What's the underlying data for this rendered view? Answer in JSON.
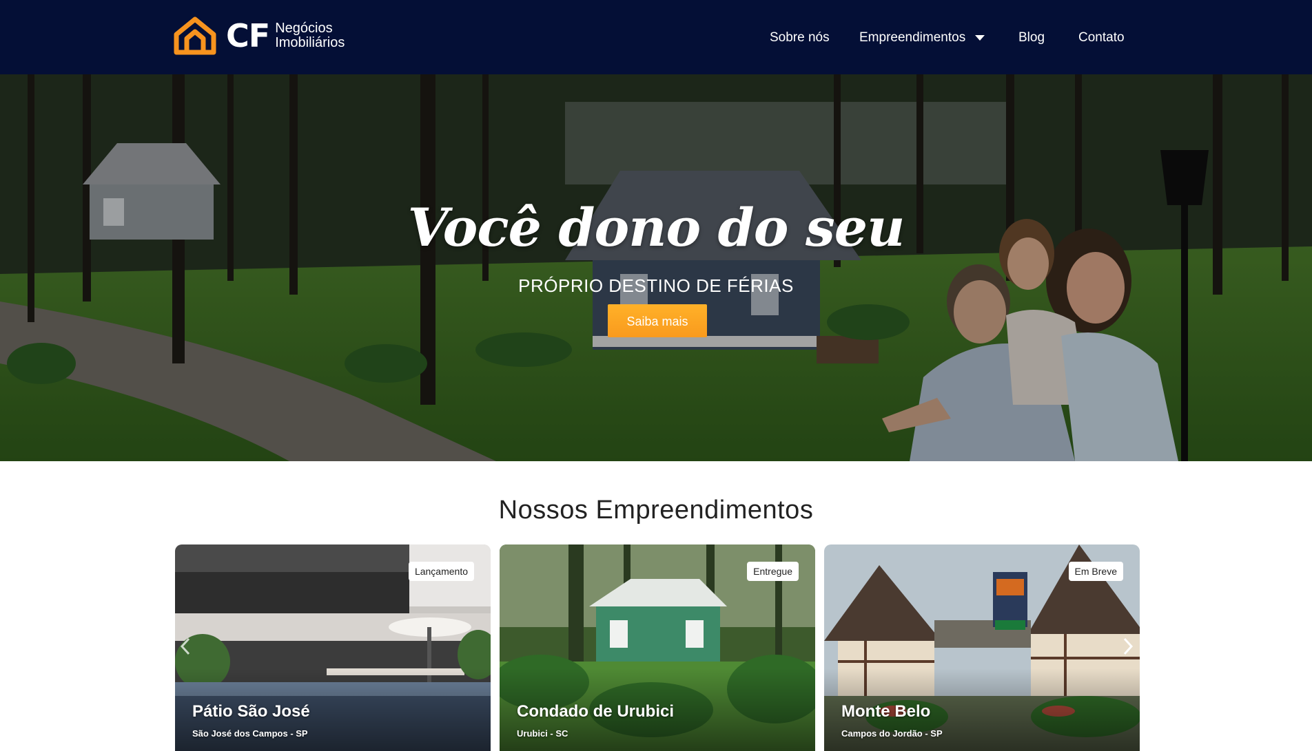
{
  "header": {
    "logo": {
      "mark": "CF",
      "line1": "Negócios",
      "line2": "Imobiliários"
    },
    "nav": [
      {
        "label": "Sobre nós"
      },
      {
        "label": "Empreendimentos",
        "icon": "caret-down-icon"
      },
      {
        "label": "Blog"
      },
      {
        "label": "Contato"
      }
    ]
  },
  "hero": {
    "title": "Você dono do seu",
    "subtitle": "PRÓPRIO DESTINO DE FÉRIAS",
    "button": "Saiba mais"
  },
  "projects": {
    "title": "Nossos Empreendimentos",
    "cards": [
      {
        "badge": "Lançamento",
        "name": "Pátio São José",
        "location": "São José dos Campos - SP"
      },
      {
        "badge": "Entregue",
        "name": "Condado de Urubici",
        "location": "Urubici - SC"
      },
      {
        "badge": "Em Breve",
        "name": "Monte Belo",
        "location": "Campos do Jordão - SP"
      }
    ]
  },
  "colors": {
    "header_bg": "#040f36",
    "accent": "#f99a1e",
    "logo_orange": "#f7931e"
  },
  "icons": [
    "logo-house-icon",
    "caret-down-icon",
    "chevron-left-icon",
    "chevron-right-icon"
  ]
}
